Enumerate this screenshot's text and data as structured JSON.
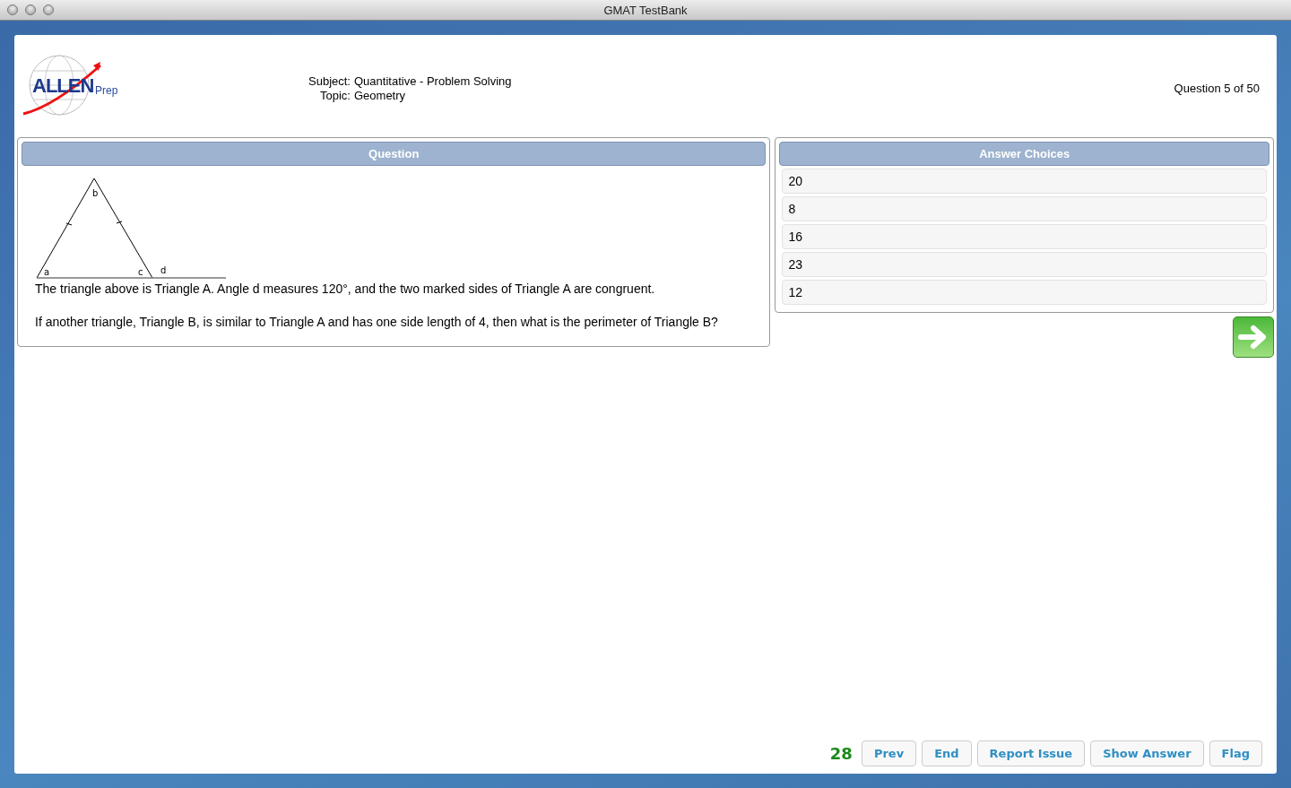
{
  "window": {
    "title": "GMAT TestBank"
  },
  "header": {
    "logo": {
      "brand": "ALLEN",
      "suffix": "Prep"
    },
    "subject_label": "Subject:",
    "subject": "Quantitative - Problem Solving",
    "topic_label": "Topic:",
    "topic": "Geometry",
    "progress": "Question 5 of 50"
  },
  "question": {
    "heading": "Question",
    "figure_labels": [
      "a",
      "b",
      "c",
      "d"
    ],
    "paragraphs": [
      "The triangle above is Triangle A. Angle d measures 120°, and the two marked sides of Triangle A are congruent.",
      "If another triangle, Triangle B, is similar to Triangle A and has one side length of 4, then what is the perimeter of Triangle B?"
    ]
  },
  "answers": {
    "heading": "Answer Choices",
    "choices": [
      {
        "label": "20",
        "selected": false
      },
      {
        "label": "8",
        "selected": false
      },
      {
        "label": "16",
        "selected": false
      },
      {
        "label": "23",
        "selected": false
      },
      {
        "label": "12",
        "selected": false
      }
    ]
  },
  "footer": {
    "timer": "28",
    "buttons": [
      "Prev",
      "End",
      "Report Issue",
      "Show Answer",
      "Flag"
    ]
  }
}
